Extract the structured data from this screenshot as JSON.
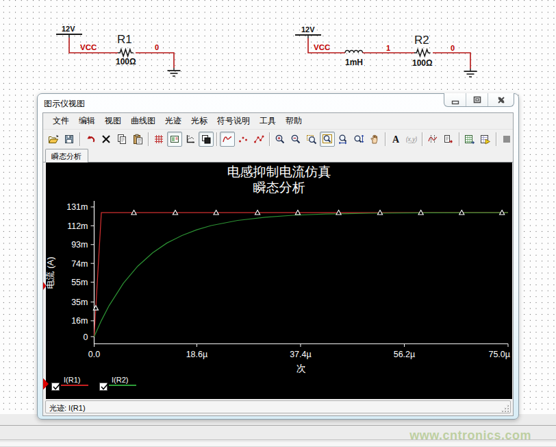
{
  "app": {
    "window_title": "图示仪视图",
    "watermark": "www.cntronics.com"
  },
  "window_controls": [
    {
      "name": "minimize"
    },
    {
      "name": "restore"
    },
    {
      "name": "close"
    }
  ],
  "menu": {
    "items": [
      "文件",
      "编辑",
      "视图",
      "曲线图",
      "光迹",
      "光标",
      "符号说明",
      "工具",
      "帮助"
    ]
  },
  "toolbar": {
    "buttons": [
      {
        "icon": "open",
        "pressed": false
      },
      {
        "icon": "save",
        "pressed": false
      },
      {
        "icon": "sep"
      },
      {
        "icon": "undo",
        "pressed": false
      },
      {
        "icon": "delete",
        "pressed": false
      },
      {
        "icon": "copy",
        "pressed": false
      },
      {
        "icon": "paste",
        "pressed": false
      },
      {
        "icon": "sep"
      },
      {
        "icon": "grid",
        "pressed": false
      },
      {
        "icon": "legend",
        "pressed": true
      },
      {
        "icon": "axes",
        "pressed": false
      },
      {
        "icon": "overlay",
        "pressed": true
      },
      {
        "icon": "sep"
      },
      {
        "icon": "line-style",
        "pressed": true
      },
      {
        "icon": "point-style",
        "pressed": false
      },
      {
        "icon": "line-point",
        "pressed": false
      },
      {
        "icon": "sep"
      },
      {
        "icon": "zoom-in",
        "pressed": false
      },
      {
        "icon": "zoom-out",
        "pressed": false
      },
      {
        "icon": "zoom-window",
        "pressed": false
      },
      {
        "icon": "zoom-fit",
        "pressed": true
      },
      {
        "icon": "zoom-h",
        "pressed": false
      },
      {
        "icon": "zoom-v",
        "pressed": false
      },
      {
        "icon": "pan",
        "pressed": false
      },
      {
        "icon": "sep"
      },
      {
        "icon": "text",
        "pressed": false
      },
      {
        "icon": "coords",
        "pressed": false,
        "disabled": true
      },
      {
        "icon": "sep"
      },
      {
        "icon": "cursors",
        "pressed": false
      },
      {
        "icon": "export-data",
        "pressed": false
      },
      {
        "icon": "sep"
      },
      {
        "icon": "export-excel",
        "pressed": false
      },
      {
        "icon": "export-labview",
        "pressed": false
      },
      {
        "icon": "sep"
      },
      {
        "icon": "stop",
        "pressed": false,
        "disabled": true
      }
    ]
  },
  "tabs": [
    {
      "label": "瞬态分析",
      "active": true
    }
  ],
  "schematic": {
    "circuit1": {
      "voltage": "12V",
      "net_vcc": "VCC",
      "ref": "R1",
      "value": "100Ω",
      "net_out": "0"
    },
    "circuit2": {
      "voltage": "12V",
      "net_vcc": "VCC",
      "l_value": "1mH",
      "net_mid": "1",
      "ref": "R2",
      "value": "100Ω",
      "net_out": "0"
    }
  },
  "chart_data": {
    "type": "line",
    "title": "电感抑制电流仿真",
    "subtitle": "瞬态分析",
    "xlabel": "次",
    "ylabel": "电流 (A)",
    "x_unit": "microseconds",
    "y_unit": "mA",
    "xlim": [
      0,
      75
    ],
    "grid": false,
    "legend_position": "bottom-left",
    "background": "#000000",
    "xticks": {
      "values": [
        0,
        18.6,
        37.4,
        56.2,
        75.0
      ],
      "labels": [
        "0.0",
        "18.6µ",
        "37.4µ",
        "56.2µ",
        "75.0µ"
      ]
    },
    "yticks": {
      "values": [
        0,
        16,
        35,
        55,
        74,
        93,
        112,
        131
      ],
      "labels": [
        "0",
        "16m",
        "35m",
        "55m",
        "74m",
        "93m",
        "112m",
        "131m"
      ]
    },
    "series": [
      {
        "name": "I(R1)",
        "color": "#d03030",
        "x": [
          0,
          1.3,
          75
        ],
        "y": [
          0,
          125.3,
          125.3
        ],
        "marker": "triangle",
        "marker_x": [
          0.3,
          7.2,
          14.7,
          22.1,
          29.6,
          36.9,
          44.3,
          51.8,
          59.2,
          66.6,
          73.9
        ]
      },
      {
        "name": "I(R2)",
        "color": "#2c9133",
        "x": [
          0,
          1.3,
          2.7,
          5.3,
          7.9,
          10.6,
          13.2,
          15.9,
          18.6,
          21.2,
          26,
          31,
          36,
          42,
          50,
          60,
          75
        ],
        "y": [
          0,
          16.2,
          31.3,
          54.0,
          71.2,
          84.7,
          94.6,
          102.2,
          108.0,
          112.2,
          117.4,
          120.7,
          122.6,
          123.9,
          124.7,
          125.1,
          125.3
        ],
        "marker": "none"
      }
    ]
  },
  "legend": {
    "traces": [
      {
        "label": "I(R1)",
        "color": "#c82020",
        "checked": true,
        "selected": true
      },
      {
        "label": "I(R2)",
        "color": "#2d9e38",
        "checked": true,
        "selected": false
      }
    ]
  },
  "statusbar": {
    "text": "光迹: I(R1)"
  }
}
